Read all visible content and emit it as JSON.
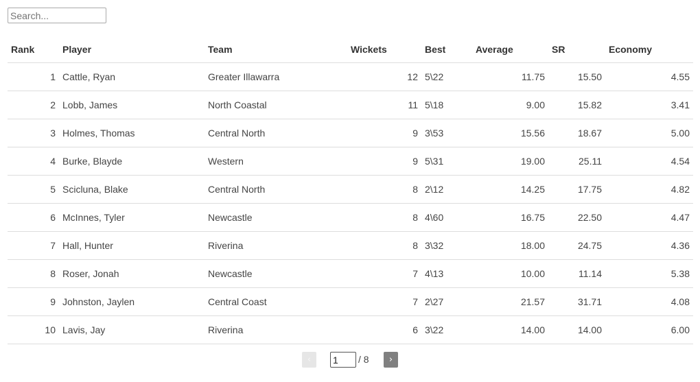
{
  "search": {
    "placeholder": "Search...",
    "value": ""
  },
  "table": {
    "columns": [
      {
        "key": "rank",
        "label": "Rank"
      },
      {
        "key": "player",
        "label": "Player"
      },
      {
        "key": "team",
        "label": "Team"
      },
      {
        "key": "wickets",
        "label": "Wickets"
      },
      {
        "key": "best",
        "label": "Best"
      },
      {
        "key": "average",
        "label": "Average"
      },
      {
        "key": "sr",
        "label": "SR"
      },
      {
        "key": "economy",
        "label": "Economy"
      }
    ],
    "rows": [
      {
        "rank": "1",
        "player": "Cattle, Ryan",
        "team": "Greater Illawarra",
        "wickets": "12",
        "best": "5\\22",
        "average": "11.75",
        "sr": "15.50",
        "economy": "4.55"
      },
      {
        "rank": "2",
        "player": "Lobb, James",
        "team": "North Coastal",
        "wickets": "11",
        "best": "5\\18",
        "average": "9.00",
        "sr": "15.82",
        "economy": "3.41"
      },
      {
        "rank": "3",
        "player": "Holmes, Thomas",
        "team": "Central North",
        "wickets": "9",
        "best": "3\\53",
        "average": "15.56",
        "sr": "18.67",
        "economy": "5.00"
      },
      {
        "rank": "4",
        "player": "Burke, Blayde",
        "team": "Western",
        "wickets": "9",
        "best": "5\\31",
        "average": "19.00",
        "sr": "25.11",
        "economy": "4.54"
      },
      {
        "rank": "5",
        "player": "Scicluna, Blake",
        "team": "Central North",
        "wickets": "8",
        "best": "2\\12",
        "average": "14.25",
        "sr": "17.75",
        "economy": "4.82"
      },
      {
        "rank": "6",
        "player": "McInnes, Tyler",
        "team": "Newcastle",
        "wickets": "8",
        "best": "4\\60",
        "average": "16.75",
        "sr": "22.50",
        "economy": "4.47"
      },
      {
        "rank": "7",
        "player": "Hall, Hunter",
        "team": "Riverina",
        "wickets": "8",
        "best": "3\\32",
        "average": "18.00",
        "sr": "24.75",
        "economy": "4.36"
      },
      {
        "rank": "8",
        "player": "Roser, Jonah",
        "team": "Newcastle",
        "wickets": "7",
        "best": "4\\13",
        "average": "10.00",
        "sr": "11.14",
        "economy": "5.38"
      },
      {
        "rank": "9",
        "player": "Johnston, Jaylen",
        "team": "Central Coast",
        "wickets": "7",
        "best": "2\\27",
        "average": "21.57",
        "sr": "31.71",
        "economy": "4.08"
      },
      {
        "rank": "10",
        "player": "Lavis, Jay",
        "team": "Riverina",
        "wickets": "6",
        "best": "3\\22",
        "average": "14.00",
        "sr": "14.00",
        "economy": "6.00"
      }
    ]
  },
  "pagination": {
    "prev_icon": "‹",
    "next_icon": "›",
    "current_page": "1",
    "total_label": "/ 8"
  }
}
